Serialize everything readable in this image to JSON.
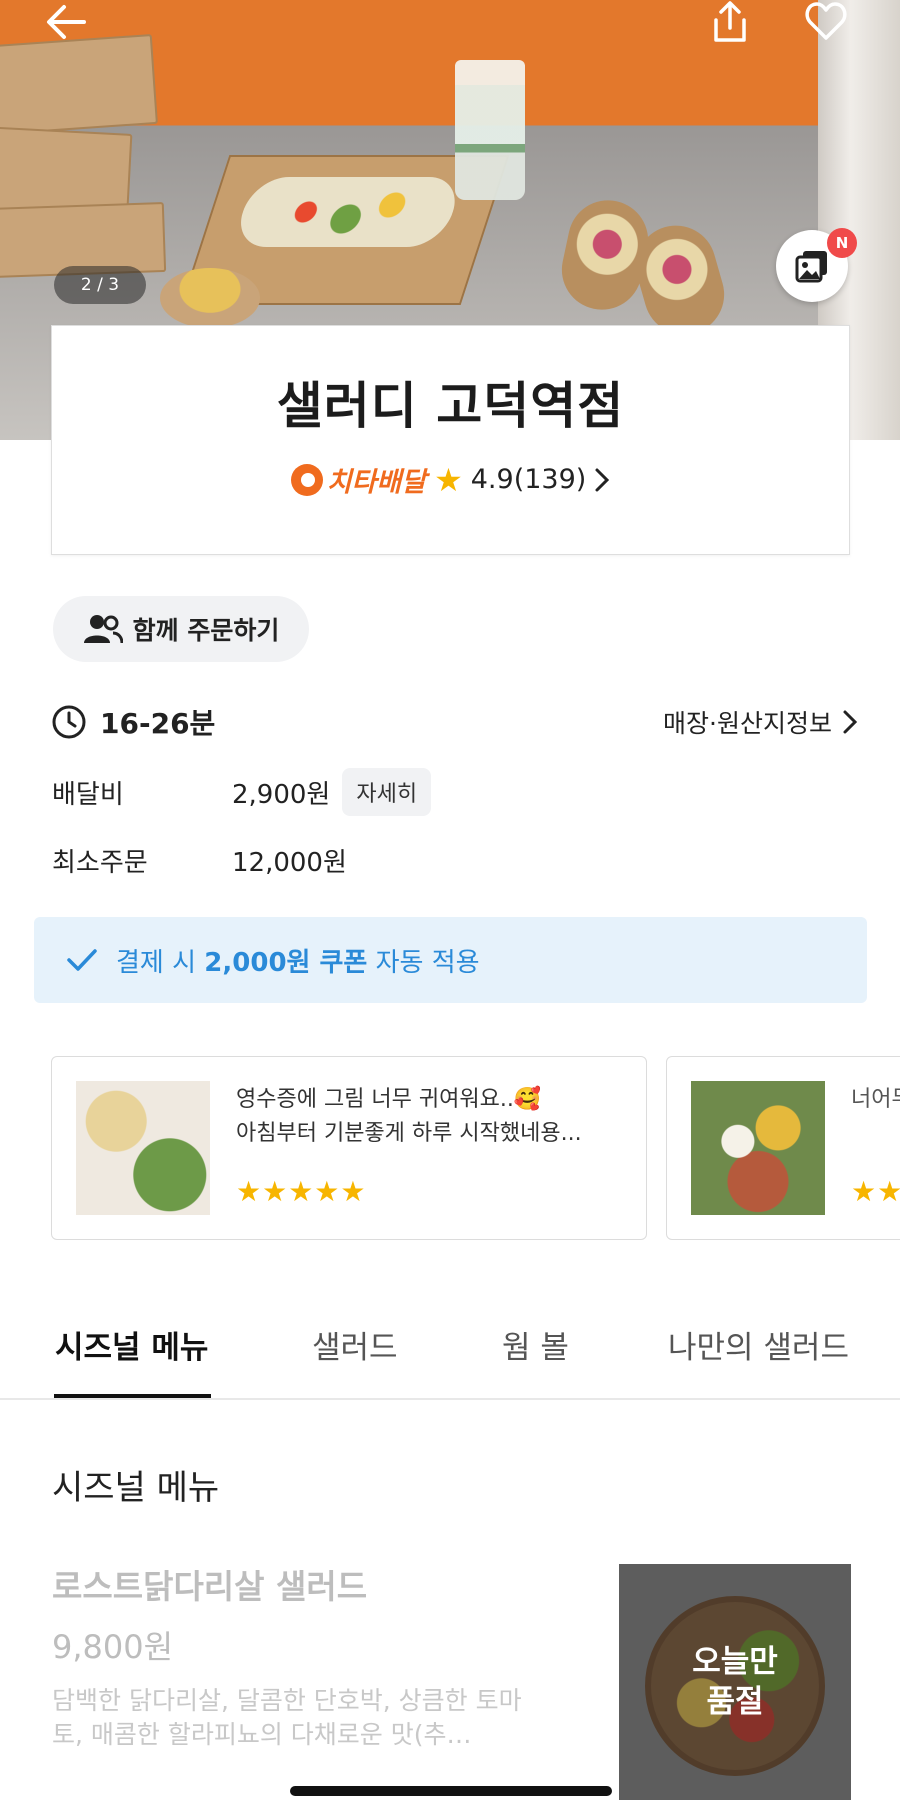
{
  "hero": {
    "image_counter": "2 / 3",
    "gallery_badge": "N",
    "icons": {
      "back": "arrow-left-icon",
      "share": "share-icon",
      "like": "heart-icon",
      "gallery": "photos-icon"
    }
  },
  "store": {
    "name": "샐러디 고덕역점",
    "delivery_brand": "치타배달",
    "rating": "4.9(139)"
  },
  "group_order": {
    "label": "함께 주문하기"
  },
  "info": {
    "delivery_time": "16-26분",
    "store_info_link": "매장·원산지정보",
    "delivery_fee_label": "배달비",
    "delivery_fee_value": "2,900원",
    "detail_label": "자세히",
    "min_order_label": "최소주문",
    "min_order_value": "12,000원"
  },
  "coupon": {
    "prefix": "결제 시",
    "highlight": "2,000원 쿠폰",
    "suffix": "자동 적용"
  },
  "reviews": [
    {
      "line1": "영수증에 그림 너무 귀여워요..🥰",
      "line2": "아침부터 기분좋게 하루 시작했네용...",
      "stars": "★★★★★"
    },
    {
      "line1": "너어무",
      "line2": "",
      "stars": "★★"
    }
  ],
  "tabs": [
    {
      "label": "시즈널 메뉴",
      "active": true
    },
    {
      "label": "샐러드",
      "active": false
    },
    {
      "label": "웜 볼",
      "active": false
    },
    {
      "label": "나만의 샐러드",
      "active": false
    }
  ],
  "section": {
    "title": "시즈널 메뉴"
  },
  "menu_item": {
    "name": "로스트닭다리살 샐러드",
    "price": "9,800원",
    "description": "담백한 닭다리살, 달콤한 단호박, 상큼한 토마토, 매콤한 할라피뇨의 다채로운 맛(추…",
    "soldout_label": "오늘만\n품절"
  },
  "colors": {
    "accent_orange": "#f06b1e",
    "star": "#f7b500",
    "coupon_blue": "#2a8ad8",
    "coupon_bg": "#e6f2fb"
  }
}
